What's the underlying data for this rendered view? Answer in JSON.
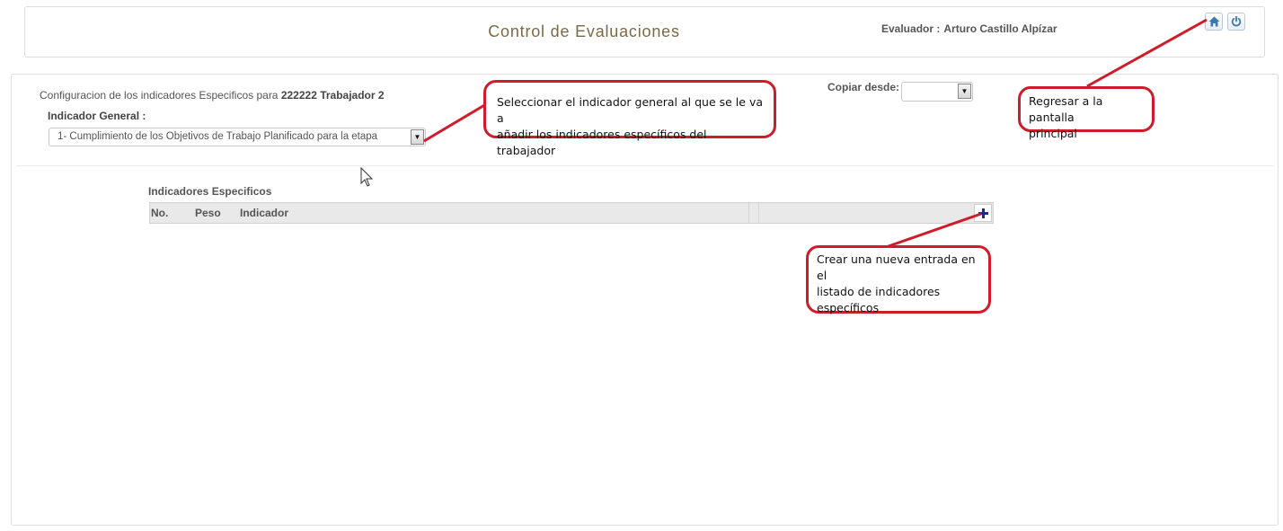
{
  "header": {
    "title": "Control de Evaluaciones",
    "evaluator_label": "Evaluador :",
    "evaluator_name": "Arturo Castillo Alpízar",
    "home_icon": "home-icon",
    "power_icon": "power-icon"
  },
  "config": {
    "prefix": "Configuracion de los indicadores Especificos para",
    "worker": "222222 Trabajador 2",
    "general_label": "Indicador General :",
    "general_value": "1- Cumplimiento de los Objetivos de Trabajo Planificado para la etapa",
    "copy_label": "Copiar desde:",
    "copy_value": ""
  },
  "table": {
    "title": "Indicadores Especificos",
    "columns": [
      "No.",
      "Peso",
      "Indicador"
    ],
    "rows": []
  },
  "annotations": {
    "indicator_note": [
      "Seleccionar el indicador general al que se le va a",
      "añadir los indicadores específicos del trabajador"
    ],
    "home_note": [
      "Regresar a la pantalla",
      "principal"
    ],
    "add_note": [
      "Crear una nueva entrada en el",
      "listado de indicadores",
      "específicos"
    ]
  },
  "colors": {
    "title": "#7a6a45",
    "callout_border": "#d01c2a",
    "icon_blue": "#3b78b5",
    "plus": "#1c2a8c"
  }
}
